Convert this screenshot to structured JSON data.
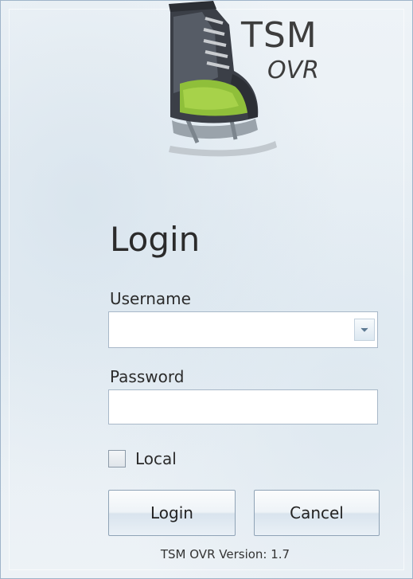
{
  "logo": {
    "name": "TSM",
    "sub": "OVR"
  },
  "login": {
    "title": "Login",
    "username_label": "Username",
    "username_value": "",
    "password_label": "Password",
    "password_value": "",
    "local_label": "Local",
    "local_checked": false,
    "login_button": "Login",
    "cancel_button": "Cancel"
  },
  "footer": {
    "version": "TSM OVR Version: 1.7"
  },
  "icons": {
    "logo": "ice-skate-icon",
    "dropdown": "chevron-down-icon"
  }
}
